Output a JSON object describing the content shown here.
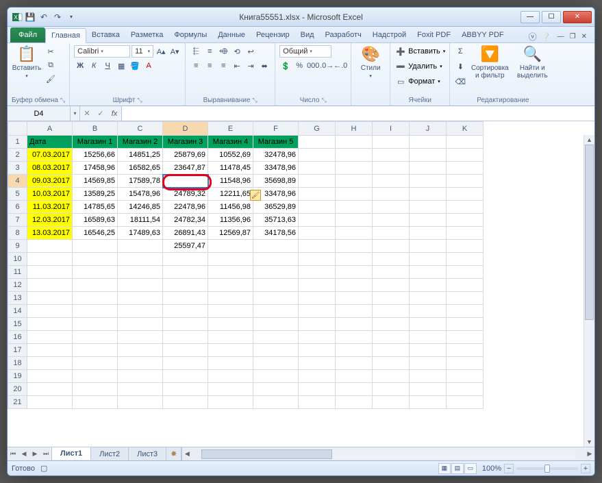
{
  "window": {
    "title": "Книга55551.xlsx - Microsoft Excel"
  },
  "qat": {
    "save": "💾",
    "undo": "↶",
    "redo": "↷",
    "more": "▾"
  },
  "tabs": {
    "file": "Файл",
    "list": [
      "Главная",
      "Вставка",
      "Разметка",
      "Формулы",
      "Данные",
      "Рецензир",
      "Вид",
      "Разработч",
      "Надстрой",
      "Foxit PDF",
      "ABBYY PDF"
    ],
    "active": "Главная"
  },
  "ribbon": {
    "clipboard": {
      "label": "Буфер обмена",
      "paste": "Вставить"
    },
    "font": {
      "label": "Шрифт",
      "name": "Calibri",
      "size": "11"
    },
    "align": {
      "label": "Выравнивание"
    },
    "number": {
      "label": "Число",
      "format": "Общий"
    },
    "styles": {
      "label": "Стили",
      "btn": "Стили"
    },
    "cells": {
      "label": "Ячейки",
      "insert": "Вставить",
      "delete": "Удалить",
      "format": "Формат"
    },
    "editing": {
      "label": "Редактирование",
      "sort": "Сортировка и фильтр",
      "find": "Найти и выделить"
    }
  },
  "formula_bar": {
    "cell_ref": "D4",
    "fx": "fx",
    "value": ""
  },
  "columns": [
    "A",
    "B",
    "C",
    "D",
    "E",
    "F",
    "G",
    "H",
    "I",
    "J",
    "K"
  ],
  "row_numbers": [
    "1",
    "2",
    "3",
    "4",
    "5",
    "6",
    "7",
    "8",
    "9",
    "10",
    "11",
    "12",
    "13",
    "14",
    "15",
    "16",
    "17",
    "18",
    "19",
    "20",
    "21"
  ],
  "headers": [
    "Дата",
    "Магазин 1",
    "Магазин 2",
    "Магазин 3",
    "Магазин 4",
    "Магазин 5"
  ],
  "rows": [
    {
      "date": "07.03.2017",
      "v": [
        "15256,66",
        "14851,25",
        "25879,69",
        "10552,69",
        "32478,96"
      ]
    },
    {
      "date": "08.03.2017",
      "v": [
        "17458,96",
        "16582,65",
        "23647,87",
        "11478,45",
        "33478,96"
      ]
    },
    {
      "date": "09.03.2017",
      "v": [
        "14569,85",
        "17589,78",
        "",
        "11548,96",
        "35698,89"
      ]
    },
    {
      "date": "10.03.2017",
      "v": [
        "13589,25",
        "15478,96",
        "24789,32",
        "12211,65",
        "33478,96"
      ]
    },
    {
      "date": "11.03.2017",
      "v": [
        "14785,65",
        "14246,85",
        "22478,96",
        "11456,98",
        "36529,89"
      ]
    },
    {
      "date": "12.03.2017",
      "v": [
        "16589,63",
        "18111,54",
        "24782,34",
        "11356,96",
        "35713,63"
      ]
    },
    {
      "date": "13.03.2017",
      "v": [
        "16546,25",
        "17489,63",
        "26891,43",
        "12569,87",
        "34178,56"
      ]
    }
  ],
  "extra_d9": "25597,47",
  "sheet_tabs": {
    "list": [
      "Лист1",
      "Лист2",
      "Лист3"
    ],
    "active": "Лист1"
  },
  "status": {
    "ready": "Готово",
    "zoom": "100%"
  }
}
